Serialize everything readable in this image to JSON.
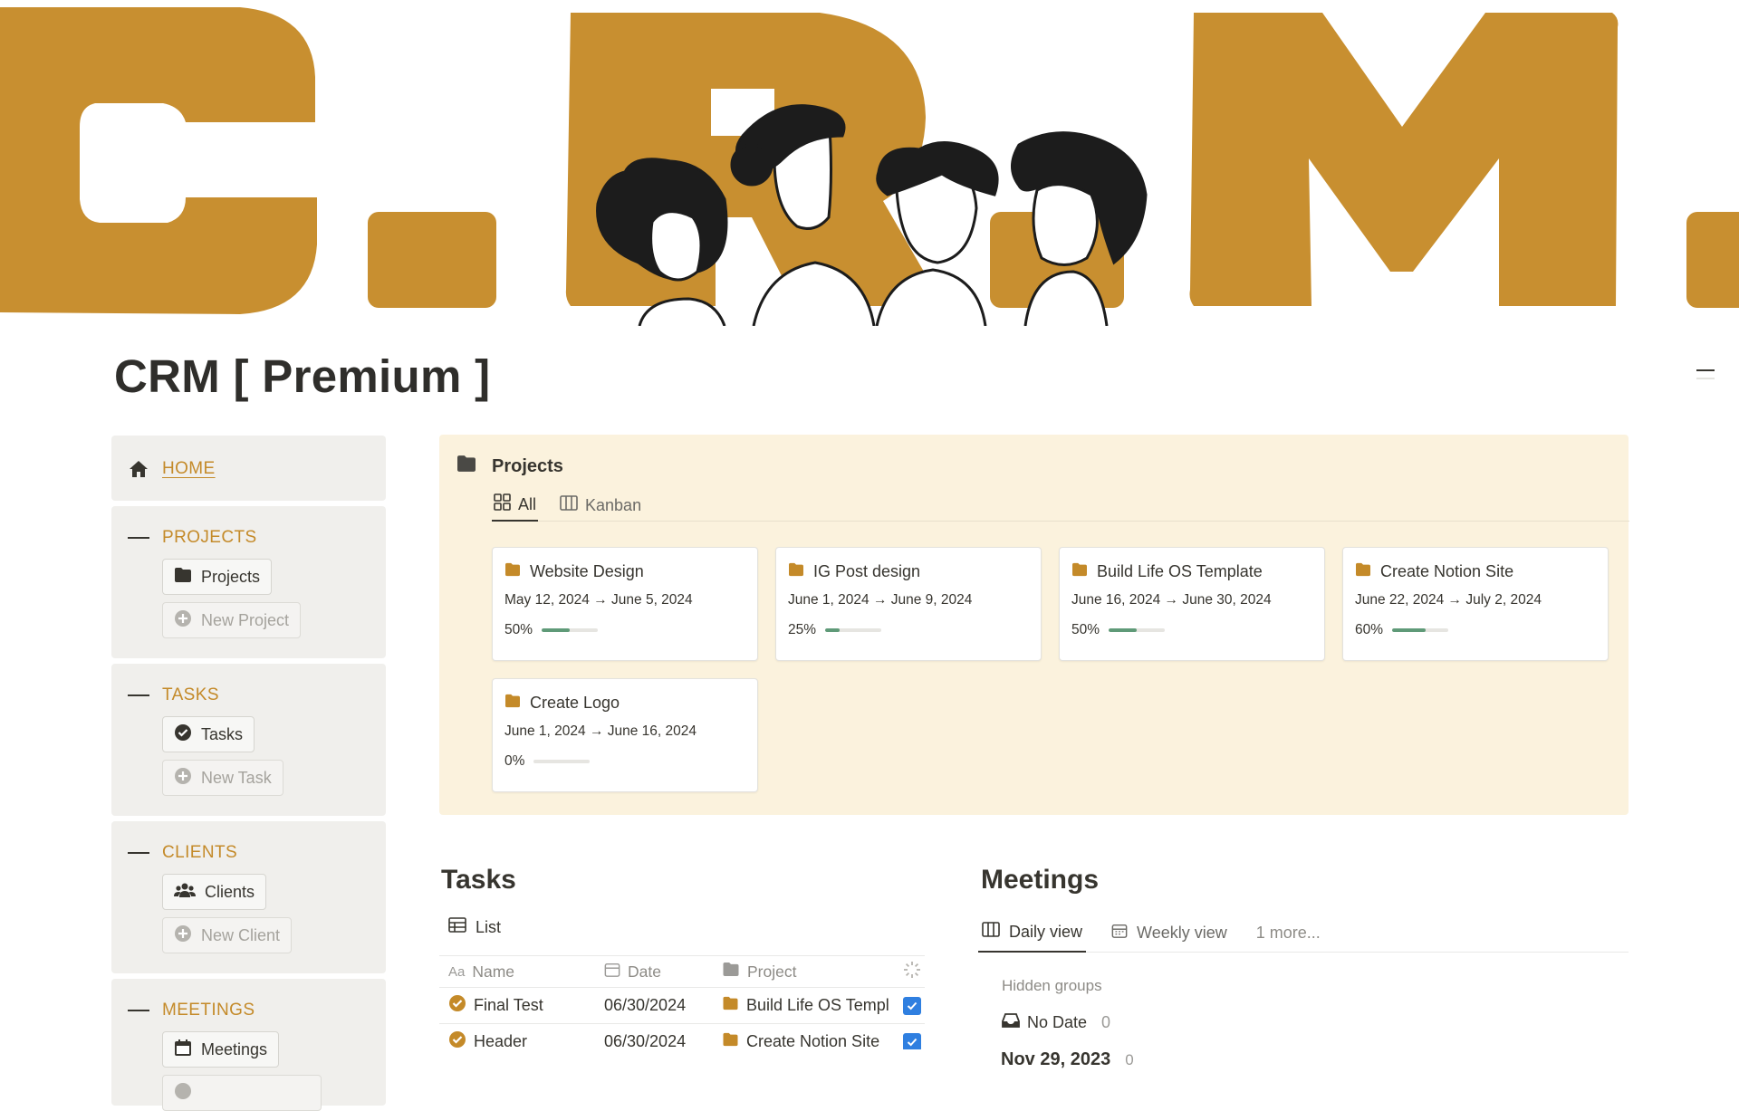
{
  "page": {
    "title": "CRM [ Premium ]",
    "cover_letters": [
      "C",
      "R",
      "M"
    ],
    "accent_color": "#c48a29",
    "panel_color": "#fbf2dd",
    "sidebar_color": "#f0efec"
  },
  "sidebar": {
    "home": {
      "label": "HOME",
      "icon": "home-icon"
    },
    "sections": [
      {
        "label": "PROJECTS",
        "button": {
          "label": "Projects",
          "icon": "folder-icon"
        },
        "new": {
          "label": "New Project"
        }
      },
      {
        "label": "TASKS",
        "button": {
          "label": "Tasks",
          "icon": "check-circle-icon"
        },
        "new": {
          "label": "New Task"
        }
      },
      {
        "label": "CLIENTS",
        "button": {
          "label": "Clients",
          "icon": "people-icon"
        },
        "new": {
          "label": "New Client"
        }
      },
      {
        "label": "MEETINGS",
        "button": {
          "label": "Meetings",
          "icon": "calendar-icon"
        },
        "new": {
          "label": ""
        }
      }
    ]
  },
  "projects": {
    "title": "Projects",
    "tabs": [
      {
        "label": "All",
        "active": true
      },
      {
        "label": "Kanban",
        "active": false
      }
    ],
    "cards": [
      {
        "name": "Website Design",
        "dates": "May 12, 2024 → June 5, 2024",
        "progress_label": "50%",
        "progress": 0.5
      },
      {
        "name": "IG Post design",
        "dates": "June 1, 2024 → June 9, 2024",
        "progress_label": "25%",
        "progress": 0.25
      },
      {
        "name": "Build Life OS Template",
        "dates": "June 16, 2024 → June 30, 2024",
        "progress_label": "50%",
        "progress": 0.5
      },
      {
        "name": "Create Notion Site",
        "dates": "June 22, 2024 → July 2, 2024",
        "progress_label": "60%",
        "progress": 0.6
      },
      {
        "name": "Create Logo",
        "dates": "June 1, 2024 → June 16, 2024",
        "progress_label": "0%",
        "progress": 0
      }
    ]
  },
  "tasks": {
    "title": "Tasks",
    "view": "List",
    "columns": {
      "name": "Name",
      "date": "Date",
      "project": "Project",
      "name_prefix": "Aa"
    },
    "rows": [
      {
        "name": "Final Test",
        "date": "06/30/2024",
        "project": "Build Life OS Templ",
        "done": true
      },
      {
        "name": "Header",
        "date": "06/30/2024",
        "project": "Create Notion Site",
        "done": true
      }
    ]
  },
  "meetings": {
    "title": "Meetings",
    "tabs": [
      {
        "label": "Daily view",
        "active": true
      },
      {
        "label": "Weekly view",
        "active": false
      },
      {
        "label": "1 more...",
        "active": false
      }
    ],
    "hidden_groups": "Hidden groups",
    "no_date": {
      "label": "No Date",
      "count": "0"
    },
    "date_group": {
      "label": "Nov 29, 2023",
      "count": "0"
    }
  }
}
